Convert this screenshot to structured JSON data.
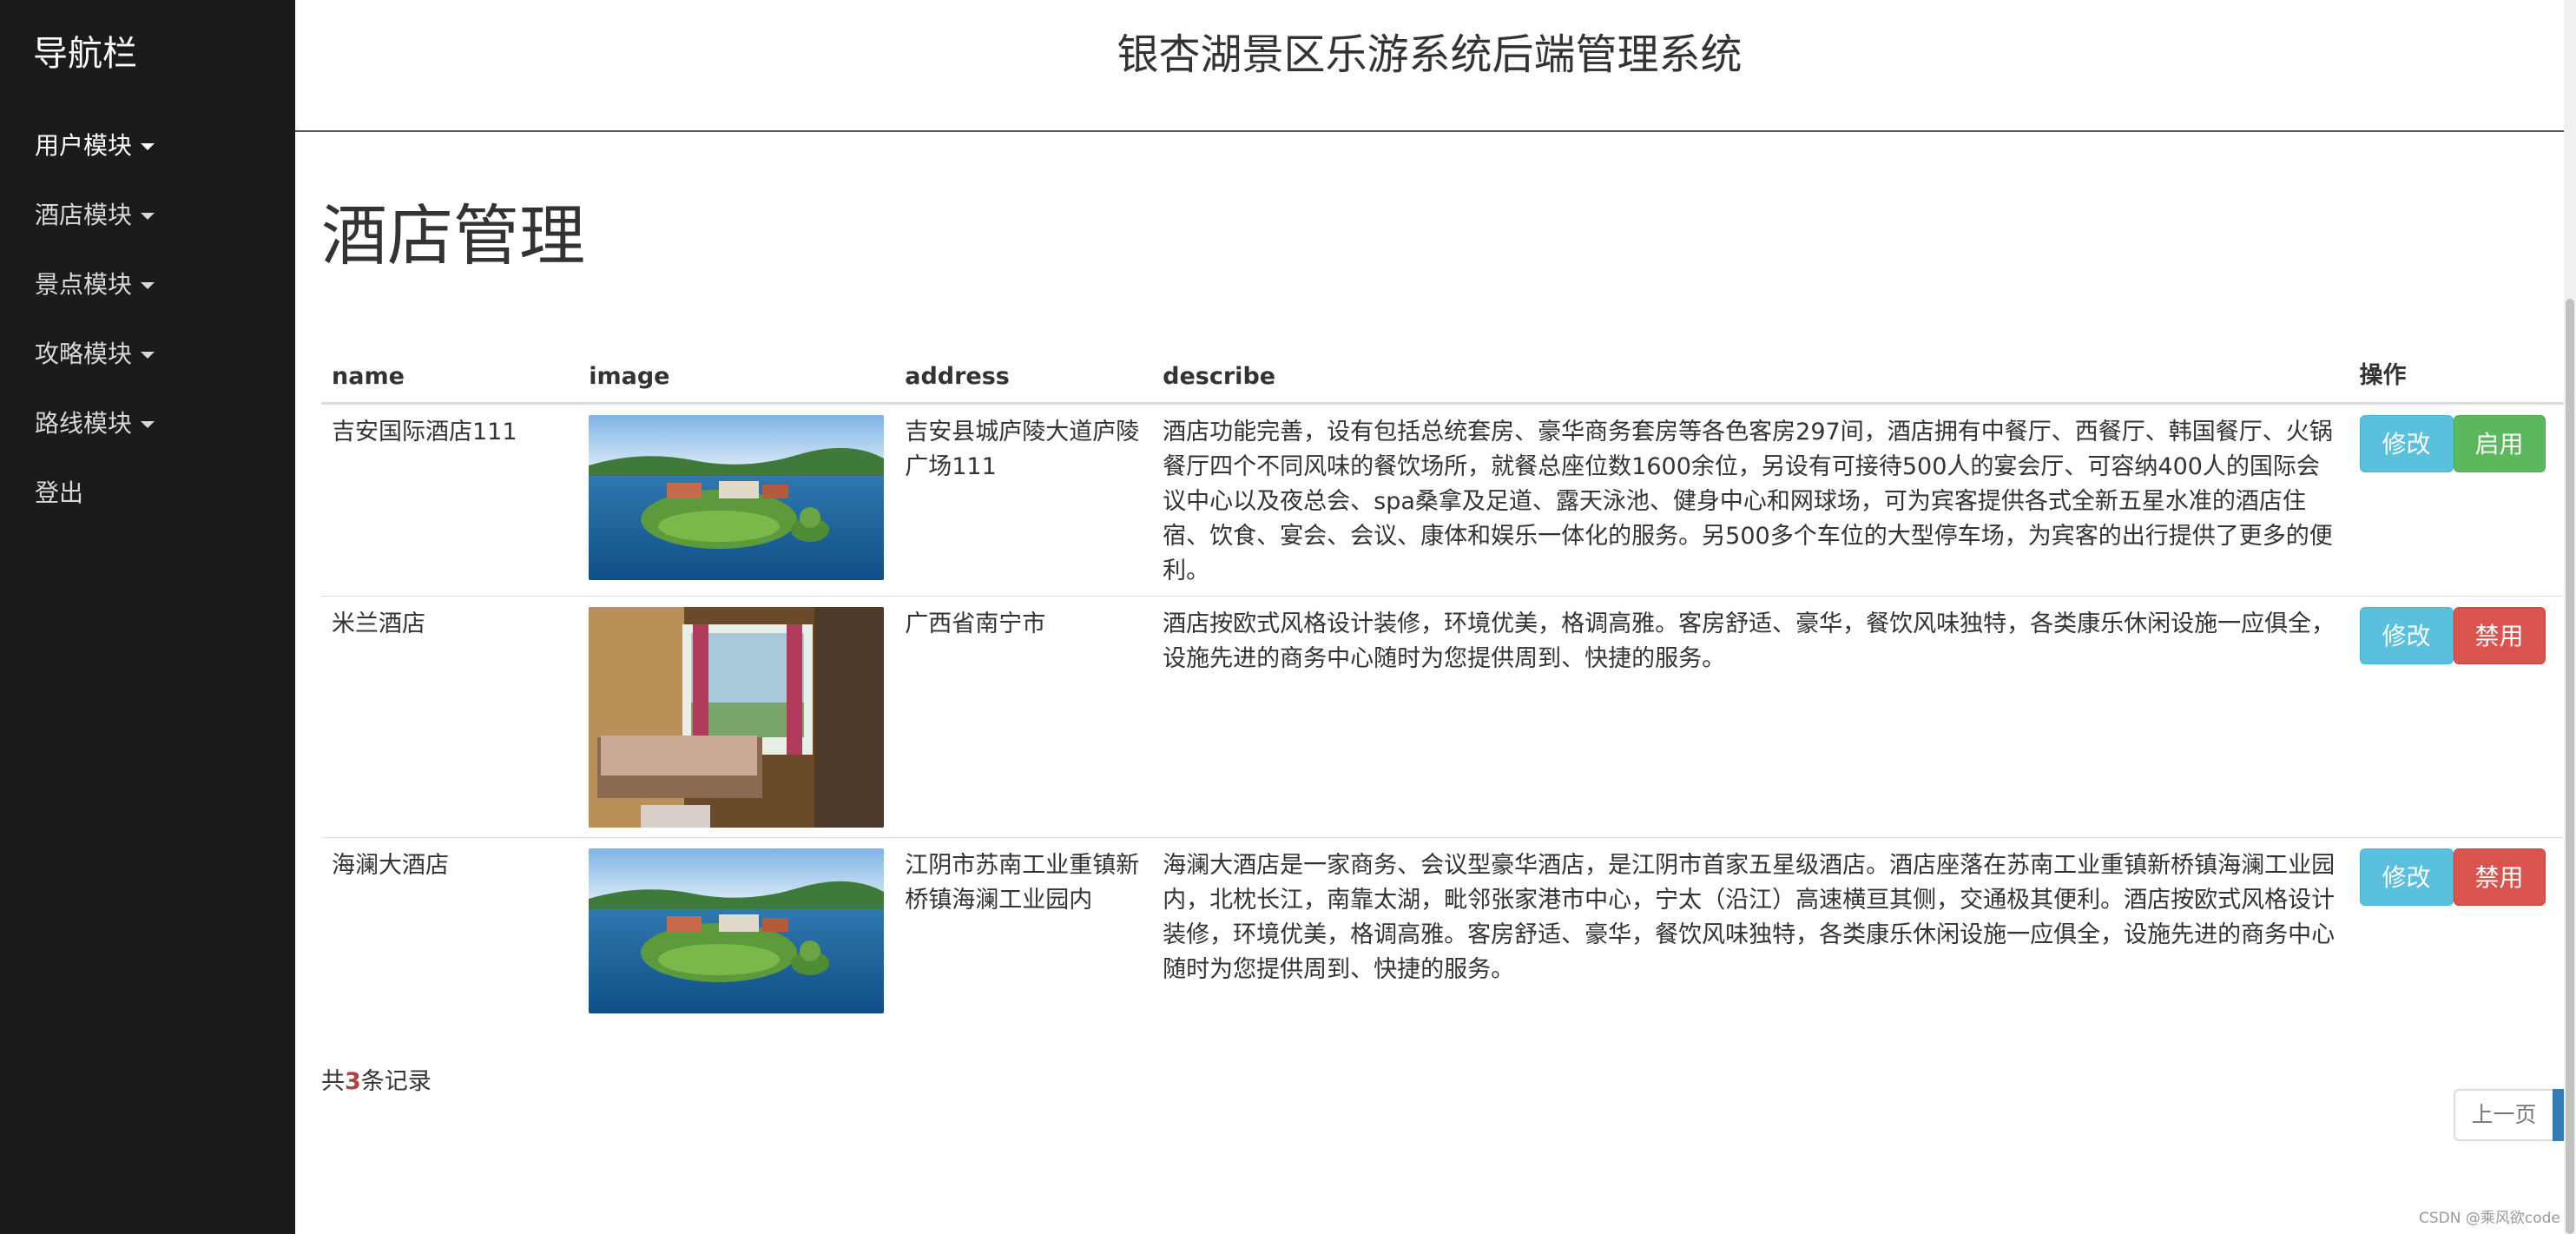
{
  "sidebar": {
    "title": "导航栏",
    "items": [
      {
        "label": "用户模块"
      },
      {
        "label": "酒店模块"
      },
      {
        "label": "景点模块"
      },
      {
        "label": "攻略模块"
      },
      {
        "label": "路线模块"
      },
      {
        "label": "登出"
      }
    ]
  },
  "header": {
    "title": "银杏湖景区乐游系统后端管理系统"
  },
  "page": {
    "title": "酒店管理"
  },
  "table": {
    "columns": [
      "name",
      "image",
      "address",
      "describe",
      "操作"
    ],
    "rows": [
      {
        "name": "吉安国际酒店111",
        "image_icon": "lake-resort-photo",
        "address": "吉安县城庐陵大道庐陵广场111",
        "describe": "酒店功能完善，设有包括总统套房、豪华商务套房等各色客房297间，酒店拥有中餐厅、西餐厅、韩国餐厅、火锅餐厅四个不同风味的餐饮场所，就餐总座位数1600余位，另设有可接待500人的宴会厅、可容纳400人的国际会议中心以及夜总会、spa桑拿及足道、露天泳池、健身中心和网球场，可为宾客提供各式全新五星水准的酒店住宿、饮食、宴会、会议、康体和娱乐一体化的服务。另500多个车位的大型停车场，为宾客的出行提供了更多的便利。",
        "edit_label": "修改",
        "toggle_label": "启用"
      },
      {
        "name": "米兰酒店",
        "image_icon": "hotel-room-photo",
        "address": "广西省南宁市",
        "describe": "酒店按欧式风格设计装修，环境优美，格调高雅。客房舒适、豪华，餐饮风味独特，各类康乐休闲设施一应俱全，设施先进的商务中心随时为您提供周到、快捷的服务。",
        "edit_label": "修改",
        "toggle_label": "禁用"
      },
      {
        "name": "海澜大酒店",
        "image_icon": "lake-resort-photo",
        "address": "江阴市苏南工业重镇新桥镇海澜工业园内",
        "describe": "海澜大酒店是一家商务、会议型豪华酒店，是江阴市首家五星级酒店。酒店座落在苏南工业重镇新桥镇海澜工业园内，北枕长江，南靠太湖，毗邻张家港市中心，宁太（沿江）高速横亘其侧，交通极其便利。酒店按欧式风格设计装修，环境优美，格调高雅。客房舒适、豪华，餐饮风味独特，各类康乐休闲设施一应俱全，设施先进的商务中心随时为您提供周到、快捷的服务。",
        "edit_label": "修改",
        "toggle_label": "禁用"
      }
    ]
  },
  "footer": {
    "count_prefix": "共",
    "count": "3",
    "count_suffix": "条记录",
    "prev_label": "上一页"
  },
  "watermark": "CSDN @乘风欲code",
  "colors": {
    "sidebar_bg": "#1b1b1b",
    "edit_btn": "#5bc0de",
    "enable_btn": "#5cb85c",
    "disable_btn": "#d9534f",
    "count_highlight": "#a94442",
    "pager_active": "#337ab7"
  }
}
